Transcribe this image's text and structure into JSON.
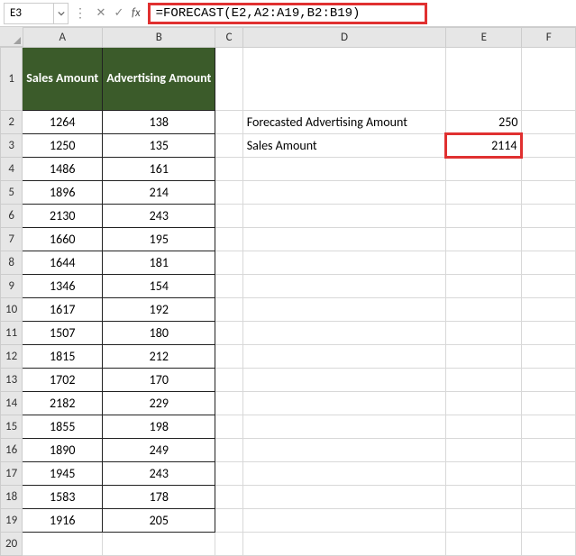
{
  "formula_bar": {
    "name_box": "E3",
    "cancel": "✕",
    "confirm": "✓",
    "fx": "fx",
    "formula": "=FORECAST(E2,A2:A19,B2:B19)"
  },
  "columns": [
    "A",
    "B",
    "C",
    "D",
    "E",
    "F"
  ],
  "row_headers": [
    "1",
    "2",
    "3",
    "4",
    "5",
    "6",
    "7",
    "8",
    "9",
    "10",
    "11",
    "12",
    "13",
    "14",
    "15",
    "16",
    "17",
    "18",
    "19",
    "20"
  ],
  "headers": {
    "A": "Sales Amount",
    "B": "Advertising Amount"
  },
  "tableAB": [
    {
      "a": "1264",
      "b": "138"
    },
    {
      "a": "1250",
      "b": "135"
    },
    {
      "a": "1486",
      "b": "161"
    },
    {
      "a": "1896",
      "b": "214"
    },
    {
      "a": "2130",
      "b": "243"
    },
    {
      "a": "1660",
      "b": "195"
    },
    {
      "a": "1644",
      "b": "181"
    },
    {
      "a": "1346",
      "b": "154"
    },
    {
      "a": "1617",
      "b": "192"
    },
    {
      "a": "1507",
      "b": "180"
    },
    {
      "a": "1815",
      "b": "212"
    },
    {
      "a": "1702",
      "b": "170"
    },
    {
      "a": "2182",
      "b": "229"
    },
    {
      "a": "1855",
      "b": "198"
    },
    {
      "a": "1890",
      "b": "249"
    },
    {
      "a": "1945",
      "b": "243"
    },
    {
      "a": "1583",
      "b": "178"
    },
    {
      "a": "1916",
      "b": "205"
    }
  ],
  "side": {
    "d2": "Forecasted Advertising Amount",
    "e2": "250",
    "d3": "Sales Amount",
    "e3": "2114"
  }
}
